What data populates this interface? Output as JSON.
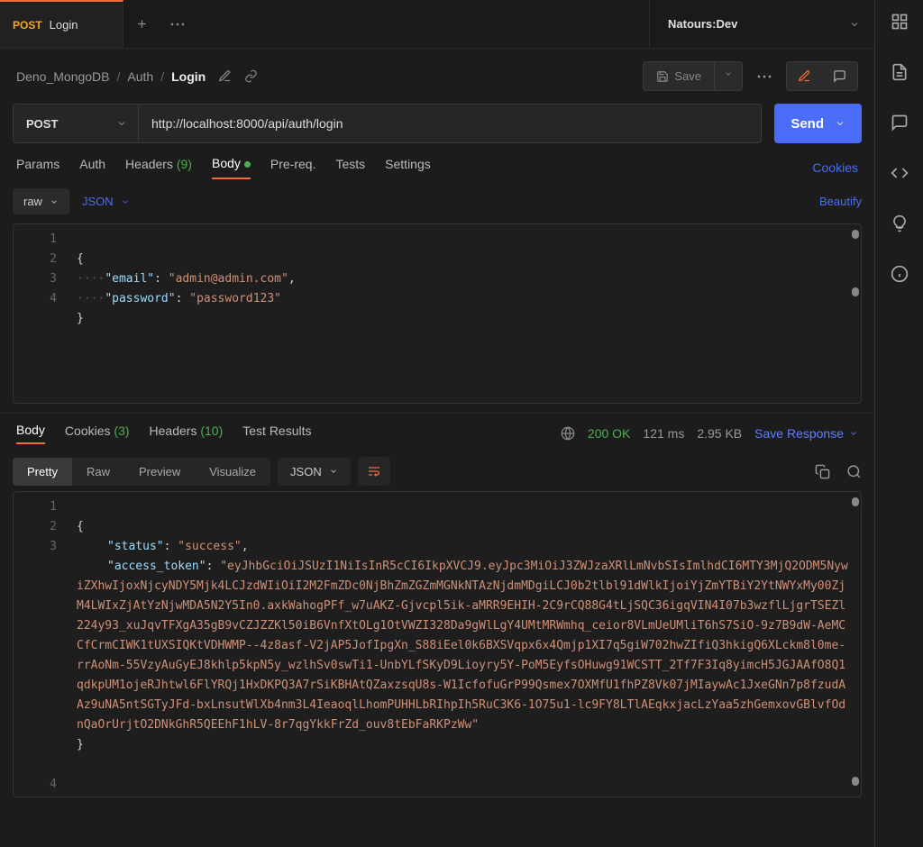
{
  "tab": {
    "method": "POST",
    "title": "Login"
  },
  "env": {
    "name": "Natours:Dev"
  },
  "breadcrumbs": {
    "seg0": "Deno_MongoDB",
    "seg1": "Auth",
    "seg2": "Login"
  },
  "save_label": "Save",
  "method": "POST",
  "url": "http://localhost:8000/api/auth/login",
  "send_label": "Send",
  "subtabs": {
    "params": "Params",
    "auth": "Auth",
    "headers": "Headers",
    "headers_count": "(9)",
    "body": "Body",
    "prereq": "Pre-req.",
    "tests": "Tests",
    "settings": "Settings",
    "cookies": "Cookies"
  },
  "bodytype": {
    "raw": "raw",
    "json": "JSON",
    "beautify": "Beautify"
  },
  "request_body": {
    "gutter": [
      "1",
      "2",
      "3",
      "4"
    ],
    "email_key": "\"email\"",
    "email_val": "\"admin@admin.com\"",
    "password_key": "\"password\"",
    "password_val": "\"password123\""
  },
  "resp_tabs": {
    "body": "Body",
    "cookies": "Cookies",
    "cookies_count": "(3)",
    "headers": "Headers",
    "headers_count": "(10)",
    "test_results": "Test Results"
  },
  "status": {
    "code": "200 OK",
    "time": "121 ms",
    "size": "2.95 KB"
  },
  "save_response": "Save Response",
  "resp_toggles": {
    "pretty": "Pretty",
    "raw": "Raw",
    "preview": "Preview",
    "visualize": "Visualize",
    "fmt": "JSON"
  },
  "response_body": {
    "gutter": [
      "1",
      "2",
      "3",
      "4"
    ],
    "status_key": "\"status\"",
    "status_val": "\"success\"",
    "token_key": "\"access_token\"",
    "token_val": "\"eyJhbGciOiJSUzI1NiIsInR5cCI6IkpXVCJ9.eyJpc3MiOiJ3ZWJzaXRlLmNvbSIsImlhdCI6MTY3MjQ2ODM5NywiZXhwIjoxNjcyNDY5Mjk4LCJzdWIiOiI2M2FmZDc0NjBhZmZGZmMGNkNTAzNjdmMDgiLCJ0b2tlbl91dWlkIjoiYjZmYTBiY2YtNWYxMy00ZjM4LWIxZjAtYzNjwMDA5N2Y5In0.axkWahogPFf_w7uAKZ-Gjvcpl5ik-aMRR9EHIH-2C9rCQ88G4tLjSQC36igqVIN4I07b3wzflLjgrTSEZl224y93_xuJqvTFXgA35gB9vCZJZZKl50iB6VnfXtOLg1OtVWZI328Da9gWlLgY4UMtMRWmhq_ceior8VLmUeUMliT6hS7SiO-9z7B9dW-AeMCCfCrmCIWK1tUXSIQKtVDHWMP--4z8asf-V2jAP5JofIpgXn_S88iEel0k6BXSVqpx6x4Qmjp1XI7q5giW702hwZIfiQ3hkigQ6XLckm8l0me-rrAoNm-55VzyAuGyEJ8khlp5kpN5y_wzlhSv0swTi1-UnbYLfSKyD9Lioyry5Y-PoM5EyfsOHuwg91WCSTT_2Tf7F3Iq8yimcH5JGJAAfO8Q1qdkpUM1ojeRJhtwl6FlYRQj1HxDKPQ3A7rSiKBHAtQZaxzsqU8s-W1IcfofuGrP99Qsmex7OXMfU1fhPZ8Vk07jMIaywAc1JxeGNn7p8fzudAAz9uNA5ntSGTyJFd-bxLnsutWlXb4nm3L4IeaoqlLhomPUHHLbRIhpIh5RuC3K6-1O75u1-lc9FY8LTlAEqkxjacLzYaa5zhGemxovGBlvfOdnQaOrUrjtO2DNkGhR5QEEhF1hLV-8r7qgYkkFrZd_ouv8tEbFaRKPzWw\""
  }
}
